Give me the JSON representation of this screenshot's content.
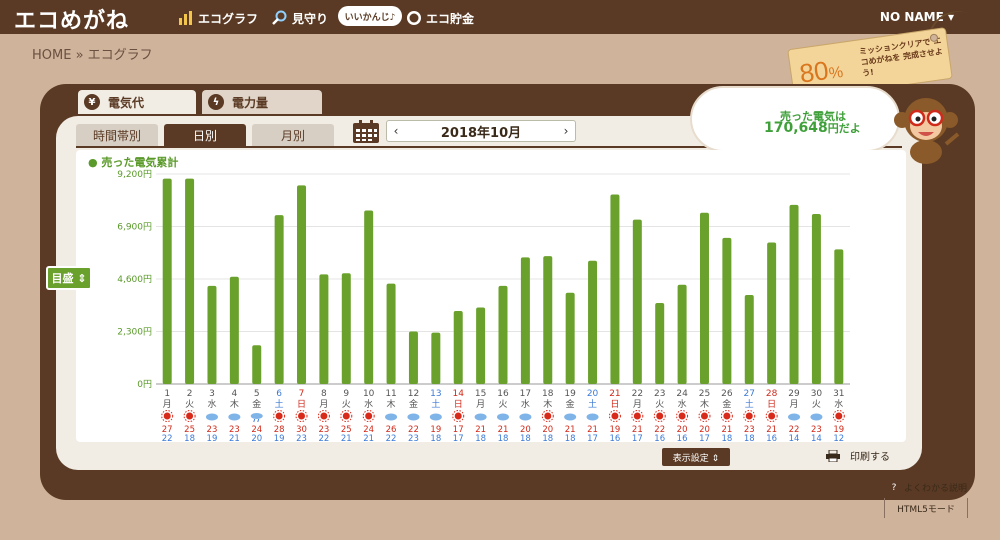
{
  "header": {
    "logo": "エコめがね",
    "nav": [
      {
        "label": "エコグラフ",
        "icon": "bar-chart-icon"
      },
      {
        "label": "見守り",
        "icon": "magnifier-icon"
      },
      {
        "label": "エコ貯金",
        "icon": "coin-icon"
      }
    ],
    "bubble": "いいかんじ♪",
    "user": "NO NAME ▾"
  },
  "breadcrumb": "HOME » エコグラフ",
  "mission": {
    "percent": "80",
    "percent_unit": "%",
    "text": "ミッションクリアで エコめがねを 完成させよう!"
  },
  "tabs": {
    "top": [
      {
        "label": "電気代",
        "icon": "yen-icon"
      },
      {
        "label": "電力量",
        "icon": "lightning-icon"
      }
    ]
  },
  "subtabs": [
    "時間帯別",
    "日別",
    "月別"
  ],
  "month_nav": {
    "prev": "‹",
    "label": "2018年10月",
    "next": "›"
  },
  "legend": "● 売った電気累計",
  "mode": "目盛 ⇕",
  "sold": {
    "label": "売った電気は",
    "value": "170,648",
    "unit": "円だよ"
  },
  "controls": {
    "display_settings": "表示設定 ⇕",
    "print": "印刷する",
    "help": "よくわかる説明",
    "html5": "HTML5モード"
  },
  "colors": {
    "bar": "#6aa12d",
    "panel": "#5a3a24",
    "sat": "#3c7ad6",
    "sun": "#d02a1a",
    "weekday": "#555555"
  },
  "chart_data": {
    "type": "bar",
    "ylim": [
      0,
      9200
    ],
    "yticks": [
      "0円",
      "2,300円",
      "4,600円",
      "6,900円",
      "9,200円"
    ],
    "ytick_values": [
      0,
      2300,
      4600,
      6900,
      9200
    ],
    "categories": [
      "1",
      "2",
      "3",
      "4",
      "5",
      "6",
      "7",
      "8",
      "9",
      "10",
      "11",
      "12",
      "13",
      "14",
      "15",
      "16",
      "17",
      "18",
      "19",
      "20",
      "21",
      "22",
      "23",
      "24",
      "25",
      "26",
      "27",
      "28",
      "29",
      "30",
      "31"
    ],
    "weekdays": [
      "月",
      "火",
      "水",
      "木",
      "金",
      "土",
      "日",
      "月",
      "火",
      "水",
      "木",
      "金",
      "土",
      "日",
      "月",
      "火",
      "水",
      "木",
      "金",
      "土",
      "日",
      "月",
      "火",
      "水",
      "木",
      "金",
      "土",
      "日",
      "月",
      "火",
      "水"
    ],
    "values": [
      9000,
      9000,
      4300,
      4700,
      1700,
      7400,
      8700,
      4800,
      4850,
      7600,
      4400,
      2300,
      2250,
      3200,
      3350,
      4300,
      5550,
      5600,
      4000,
      5400,
      8300,
      7200,
      3550,
      4350,
      7500,
      6400,
      3900,
      6200,
      7850,
      7450,
      5900
    ],
    "weather": [
      "sun",
      "sun",
      "cloud",
      "cloud",
      "rain",
      "sun",
      "sun",
      "sun",
      "sun",
      "sun",
      "cloud",
      "cloud",
      "cloud",
      "sun",
      "cloud",
      "cloud",
      "cloud",
      "sun",
      "cloud",
      "cloud",
      "sun",
      "sun",
      "sun",
      "sun",
      "sun",
      "sun",
      "sun",
      "sun",
      "cloud",
      "cloud",
      "sun"
    ],
    "temp_high": [
      "27",
      "25",
      "23",
      "23",
      "24",
      "28",
      "30",
      "23",
      "25",
      "24",
      "26",
      "22",
      "19",
      "17",
      "21",
      "21",
      "20",
      "20",
      "21",
      "21",
      "19",
      "21",
      "22",
      "20",
      "20",
      "21",
      "23",
      "21",
      "22",
      "23",
      "19"
    ],
    "temp_low": [
      "22",
      "18",
      "19",
      "21",
      "20",
      "19",
      "23",
      "22",
      "21",
      "21",
      "22",
      "23",
      "18",
      "17",
      "18",
      "18",
      "18",
      "18",
      "18",
      "17",
      "16",
      "17",
      "16",
      "16",
      "17",
      "18",
      "18",
      "16",
      "14",
      "14",
      "12"
    ]
  }
}
